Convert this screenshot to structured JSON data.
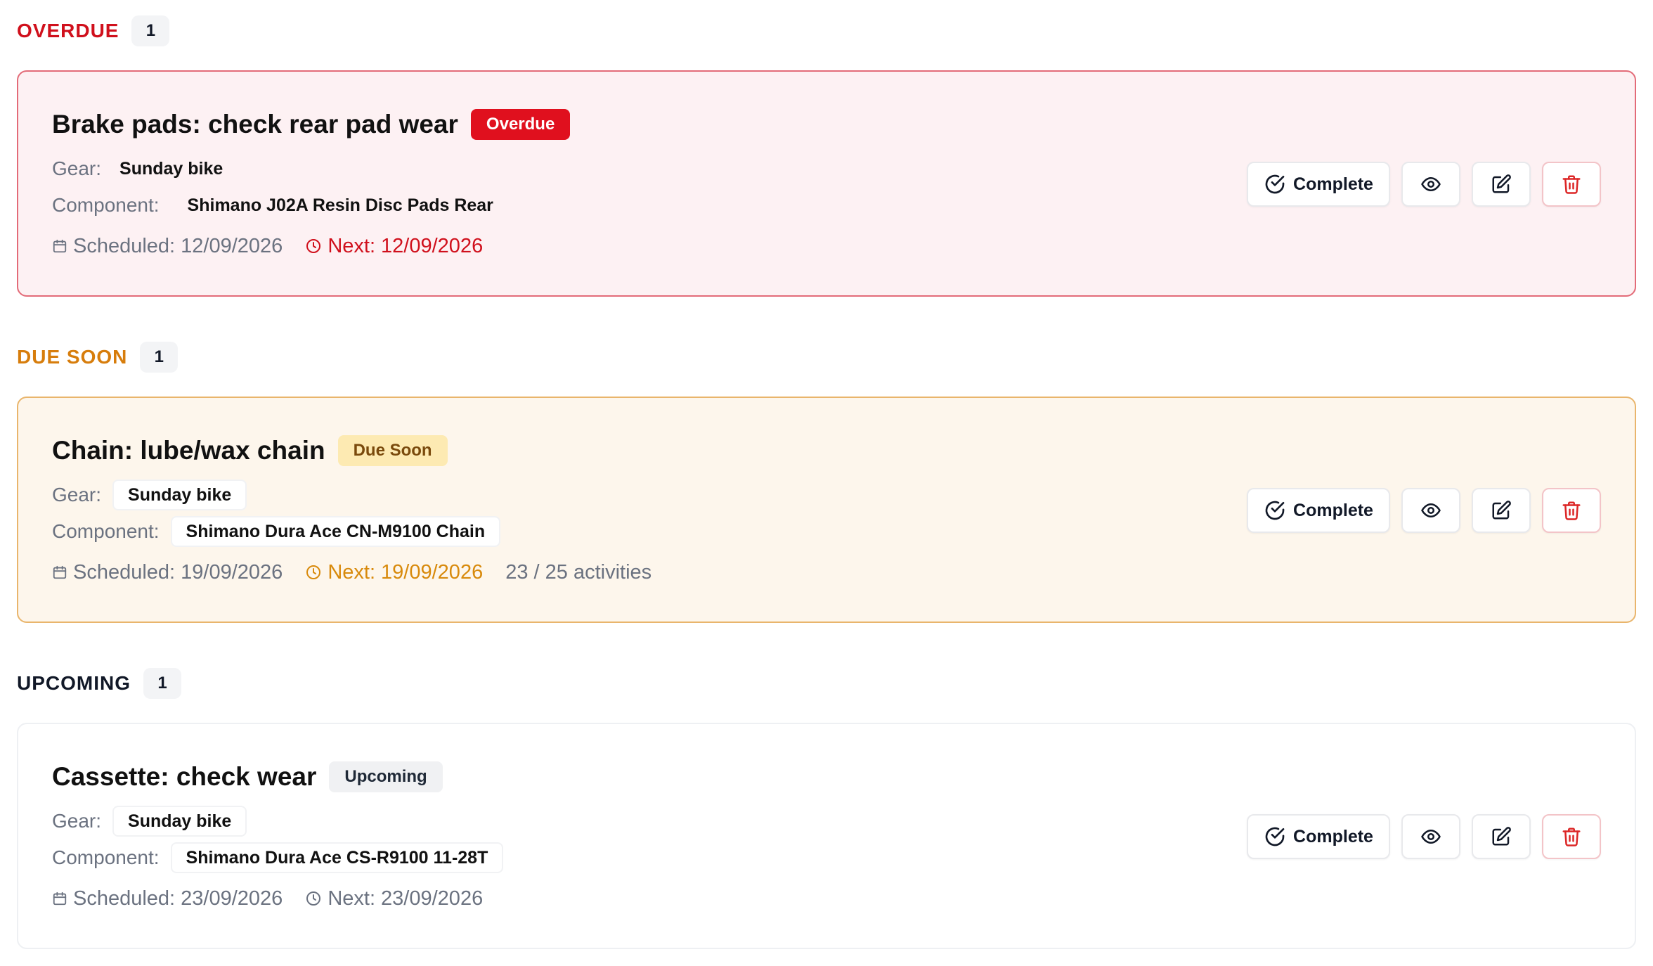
{
  "sections": [
    {
      "title": "OVERDUE",
      "count": "1",
      "title_color": "#d0101c",
      "task": {
        "title": "Brake pads: check rear pad wear",
        "status": "Overdue",
        "gear_label": "Gear:",
        "gear": "Sunday bike",
        "component_label": "Component:",
        "component": "Shimano J02A Resin Disc Pads Rear",
        "scheduled": "Scheduled: 12/09/2026",
        "next": "Next: 12/09/2026"
      }
    },
    {
      "title": "DUE SOON",
      "count": "1",
      "title_color": "#d77d0c",
      "task": {
        "title": "Chain: lube/wax chain",
        "status": "Due Soon",
        "gear_label": "Gear:",
        "gear": "Sunday bike",
        "component_label": "Component:",
        "component": "Shimano Dura Ace CN-M9100 Chain",
        "scheduled": "Scheduled: 19/09/2026",
        "next": "Next: 19/09/2026",
        "activities": "23 / 25 activities"
      }
    },
    {
      "title": "UPCOMING",
      "count": "1",
      "title_color": "#111827",
      "task": {
        "title": "Cassette: check wear",
        "status": "Upcoming",
        "gear_label": "Gear:",
        "gear": "Sunday bike",
        "component_label": "Component:",
        "component": "Shimano Dura Ace CS-R9100 11-28T",
        "scheduled": "Scheduled: 23/09/2026",
        "next": "Next: 23/09/2026"
      }
    }
  ],
  "actions": {
    "complete_label": "Complete",
    "icons": [
      "check-circle-icon",
      "eye-icon",
      "edit-icon",
      "trash-icon"
    ]
  }
}
